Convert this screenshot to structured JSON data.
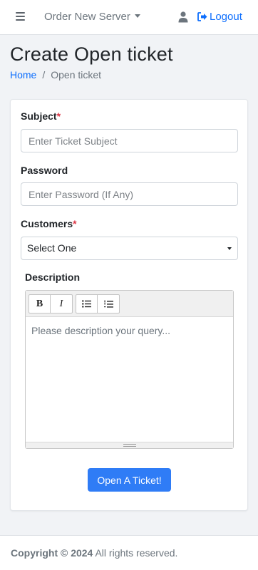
{
  "navbar": {
    "menu_icon": "hamburger-icon",
    "dropdown_label": "Order New Server",
    "user_icon": "user-icon",
    "logout_label": "Logout",
    "logout_icon": "sign-out-icon"
  },
  "page": {
    "title": "Create Open ticket",
    "breadcrumb": {
      "home": "Home",
      "separator": "/",
      "current": "Open ticket"
    }
  },
  "form": {
    "subject": {
      "label": "Subject",
      "required_mark": "*",
      "placeholder": "Enter Ticket Subject",
      "value": ""
    },
    "password": {
      "label": "Password",
      "placeholder": "Enter Password (If Any)",
      "value": ""
    },
    "customers": {
      "label": "Customers",
      "required_mark": "*",
      "selected": "Select One"
    },
    "description": {
      "label": "Description",
      "placeholder": "Please description your query...",
      "toolbar": {
        "bold": "B",
        "italic": "I",
        "bullet_list_icon": "unordered-list-icon",
        "numbered_list_icon": "ordered-list-icon"
      }
    },
    "submit_label": "Open A Ticket!"
  },
  "footer": {
    "copyright": "Copyright © 2024",
    "rights": "All rights reserved."
  },
  "colors": {
    "primary": "#0d6efd",
    "button": "#2f7cf6",
    "required": "#dc3545",
    "background": "#f1f3f6"
  }
}
